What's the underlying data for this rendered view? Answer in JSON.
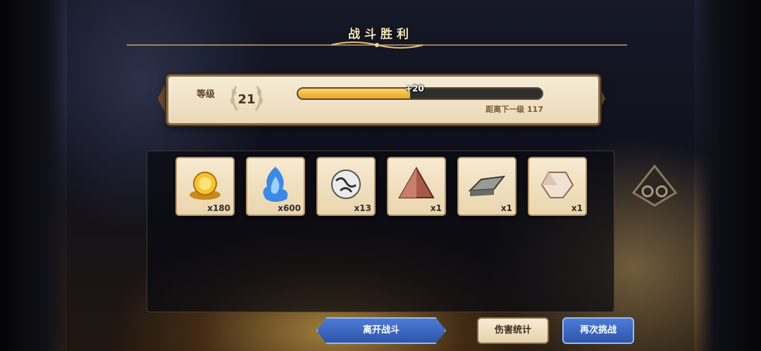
{
  "header": {
    "title": "战斗胜利"
  },
  "level": {
    "label": "等级",
    "value": "21",
    "xp_gain": "+20",
    "progress": 0.46,
    "remaining_text": "距离下一级 117"
  },
  "rewards": [
    {
      "icon": "gold-coin-icon",
      "count": "x180"
    },
    {
      "icon": "blue-flame-icon",
      "count": "x600"
    },
    {
      "icon": "sealed-orb-icon",
      "count": "x13"
    },
    {
      "icon": "red-crystal-pyramid-icon",
      "count": "x1"
    },
    {
      "icon": "stone-slab-icon",
      "count": "x1"
    },
    {
      "icon": "pale-gem-icon",
      "count": "x1"
    }
  ],
  "buttons": {
    "leave": "离开战斗",
    "damage_stats": "伤害统计",
    "retry": "再次挑战"
  },
  "colors": {
    "accent_gold": "#e8a424",
    "button_blue": "#2e55a8",
    "parchment": "#f6ecd6"
  }
}
